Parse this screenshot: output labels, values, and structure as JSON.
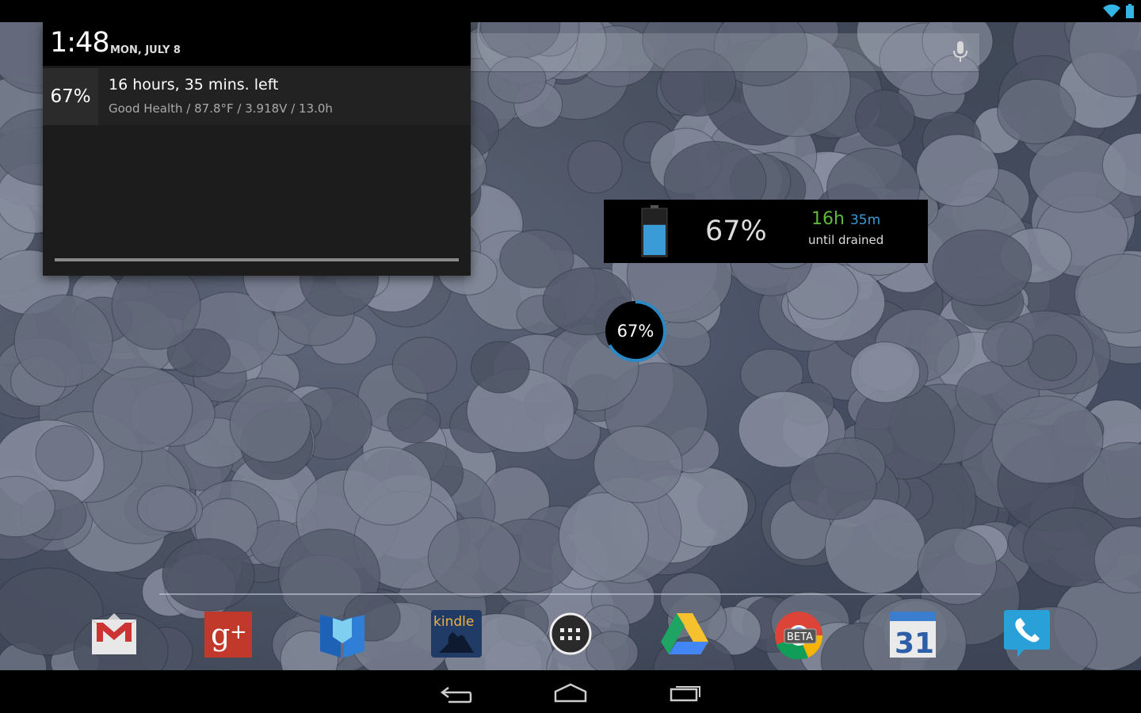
{
  "status_bar": {
    "wifi_icon": "wifi-icon",
    "battery_icon": "battery-icon"
  },
  "search_bar": {
    "mic_icon": "mic-icon"
  },
  "notification_panel": {
    "time": "1:48",
    "date": "MON, JULY 8",
    "battery_notification": {
      "percent": "67%",
      "title": "16 hours, 35 mins. left",
      "detail": "Good Health / 87.8°F / 3.918V / 13.0h"
    }
  },
  "battery_widget": {
    "percent": "67%",
    "hours": "16h",
    "minutes": "35m",
    "subtitle": "until drained",
    "level": 0.67,
    "colors": {
      "hours": "#5fb83a",
      "minutes": "#3b9bd6"
    }
  },
  "circle_widget": {
    "percent": "67%",
    "level": 0.67,
    "ring_color": "#2a88c5"
  },
  "dock": {
    "apps": [
      {
        "name": "gmail-icon"
      },
      {
        "name": "google-plus-icon"
      },
      {
        "name": "play-books-icon"
      },
      {
        "name": "kindle-icon",
        "label": "kindle"
      },
      {
        "name": "app-drawer-icon"
      },
      {
        "name": "google-drive-icon"
      },
      {
        "name": "chrome-beta-icon",
        "label": "BETA"
      },
      {
        "name": "calendar-icon",
        "label": "31"
      },
      {
        "name": "phone-icon"
      }
    ]
  },
  "nav_bar": {
    "back": "back-icon",
    "home": "home-icon",
    "recents": "recents-icon"
  }
}
